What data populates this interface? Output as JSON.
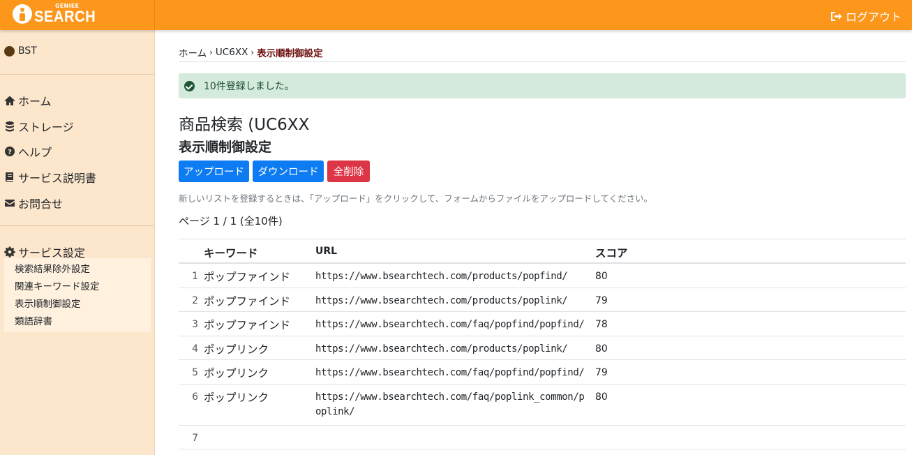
{
  "header": {
    "logo_small": "GENIEE",
    "logo_text": "SEARCH",
    "logout_label": "ログアウト"
  },
  "sidebar": {
    "user": "BST",
    "items": [
      {
        "label": "ホーム",
        "icon": "home-icon"
      },
      {
        "label": "ストレージ",
        "icon": "database-icon"
      },
      {
        "label": "ヘルプ",
        "icon": "question-circle-icon"
      },
      {
        "label": "サービス説明書",
        "icon": "book-icon"
      },
      {
        "label": "お問合せ",
        "icon": "envelope-icon"
      }
    ],
    "settings_label": "サービス設定",
    "settings_items": [
      "検索結果除外設定",
      "関連キーワード設定",
      "表示順制御設定",
      "類語辞書"
    ]
  },
  "breadcrumb": {
    "home": "ホーム",
    "project": "UC6XX",
    "current": "表示順制御設定",
    "separator": "›"
  },
  "alert": {
    "message": "10件登録しました。"
  },
  "page": {
    "title": "商品検索 (UC6XX",
    "subtitle": "表示順制御設定",
    "upload_label": "アップロード",
    "download_label": "ダウンロード",
    "delete_label": "全削除",
    "help_text": "新しいリストを登録するときは、「アップロード」をクリックして、フォームからファイルをアップロードしてください。",
    "page_info": "ページ 1 / 1 (全10件)"
  },
  "table": {
    "headers": {
      "keyword": "キーワード",
      "url": "URL",
      "score": "スコア"
    },
    "rows": [
      {
        "num": "1",
        "keyword": "ポップファインド",
        "url": "https://www.bsearchtech.com/products/popfind/",
        "score": "80"
      },
      {
        "num": "2",
        "keyword": "ポップファインド",
        "url": "https://www.bsearchtech.com/products/poplink/",
        "score": "79"
      },
      {
        "num": "3",
        "keyword": "ポップファインド",
        "url": "https://www.bsearchtech.com/faq/popfind/popfind/",
        "score": "78"
      },
      {
        "num": "4",
        "keyword": "ポップリンク",
        "url": "https://www.bsearchtech.com/products/poplink/",
        "score": "80"
      },
      {
        "num": "5",
        "keyword": "ポップリンク",
        "url": "https://www.bsearchtech.com/faq/popfind/popfind/",
        "score": "79"
      },
      {
        "num": "6",
        "keyword": "ポップリンク",
        "url": "https://www.bsearchtech.com/faq/poplink_common/poplink/",
        "score": "80"
      },
      {
        "num": "7",
        "keyword": "",
        "url": "",
        "score": ""
      }
    ]
  },
  "colors": {
    "header_orange": "#fd971c",
    "sidebar_bg": "#fde7cc",
    "primary_blue": "#0d7cf2",
    "danger_red": "#dc3545",
    "alert_green_bg": "#d4eadc"
  }
}
